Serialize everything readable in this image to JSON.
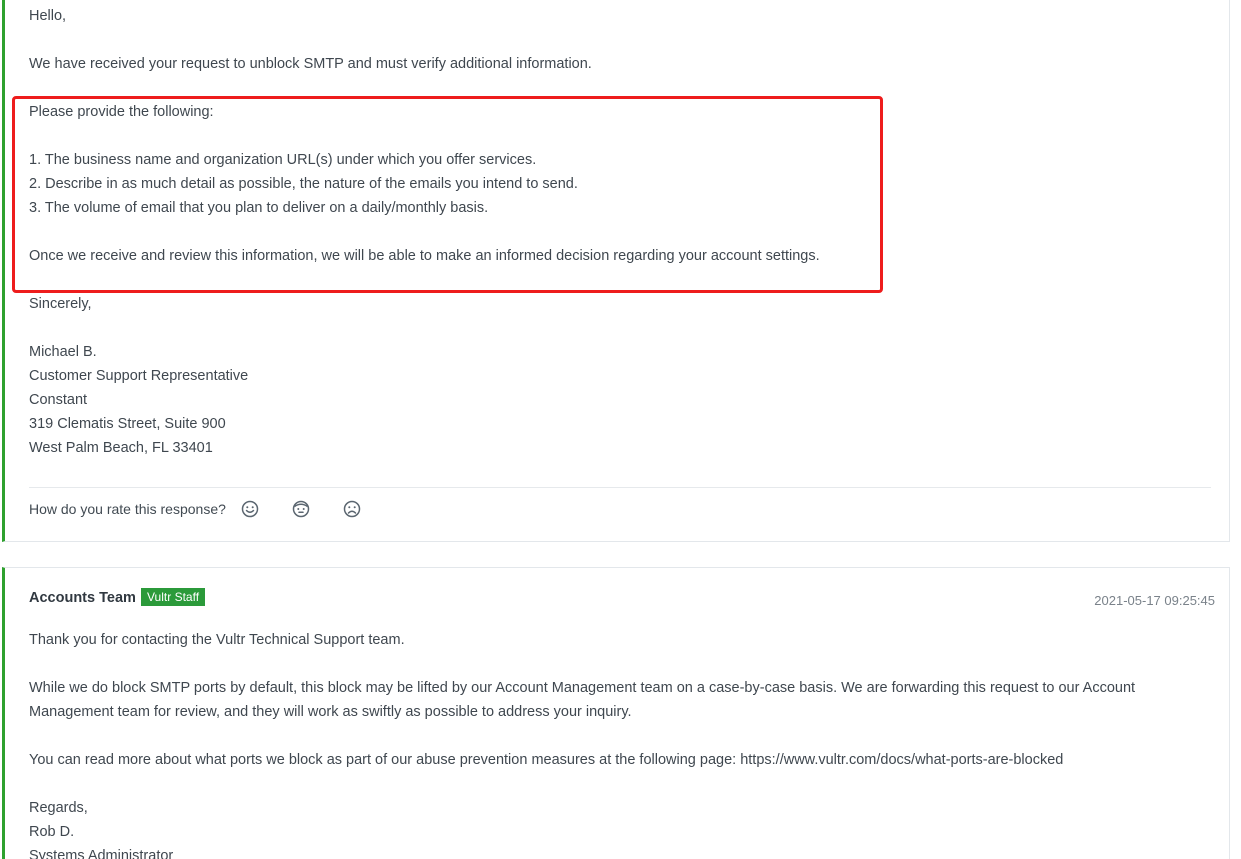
{
  "message1": {
    "greeting": "Hello,",
    "intro": "We have received your request to unblock SMTP and must verify additional information.",
    "request_heading": "Please provide the following:",
    "items": [
      "1. The business name and organization URL(s) under which you offer services.",
      "2. Describe in as much detail as possible, the nature of the emails you intend to send.",
      "3. The volume of email that you plan to deliver on a daily/monthly basis."
    ],
    "closing_note": "Once we receive and review this information, we will be able to make an informed decision regarding your account settings.",
    "signoff": "Sincerely,",
    "signature": [
      "Michael B.",
      "Customer Support Representative",
      "Constant",
      "319 Clematis Street, Suite 900",
      "West Palm Beach, FL 33401"
    ],
    "rating": {
      "prompt": "How do you rate this response?",
      "options": [
        "smile-icon",
        "neutral-face-icon",
        "frown-icon"
      ]
    }
  },
  "message2": {
    "author": "Accounts Team",
    "badge": "Vultr Staff",
    "timestamp": "2021-05-17 09:25:45",
    "paragraphs": [
      "Thank you for contacting the Vultr Technical Support team.",
      "While we do block SMTP ports by default, this block may be lifted by our Account Management team on a case-by-case basis. We are forwarding this request to our Account Management team for review, and they will work as swiftly as possible to address your inquiry.",
      "You can read more about what ports we block as part of our abuse prevention measures at the following page: https://www.vultr.com/docs/what-ports-are-blocked"
    ],
    "signoff": "Regards,",
    "signature": [
      "Rob D.",
      "Systems Administrator"
    ]
  },
  "colors": {
    "accent_border": "#2ea12e",
    "badge_bg": "#2b9a3a",
    "highlight": "#ee1c1c"
  }
}
